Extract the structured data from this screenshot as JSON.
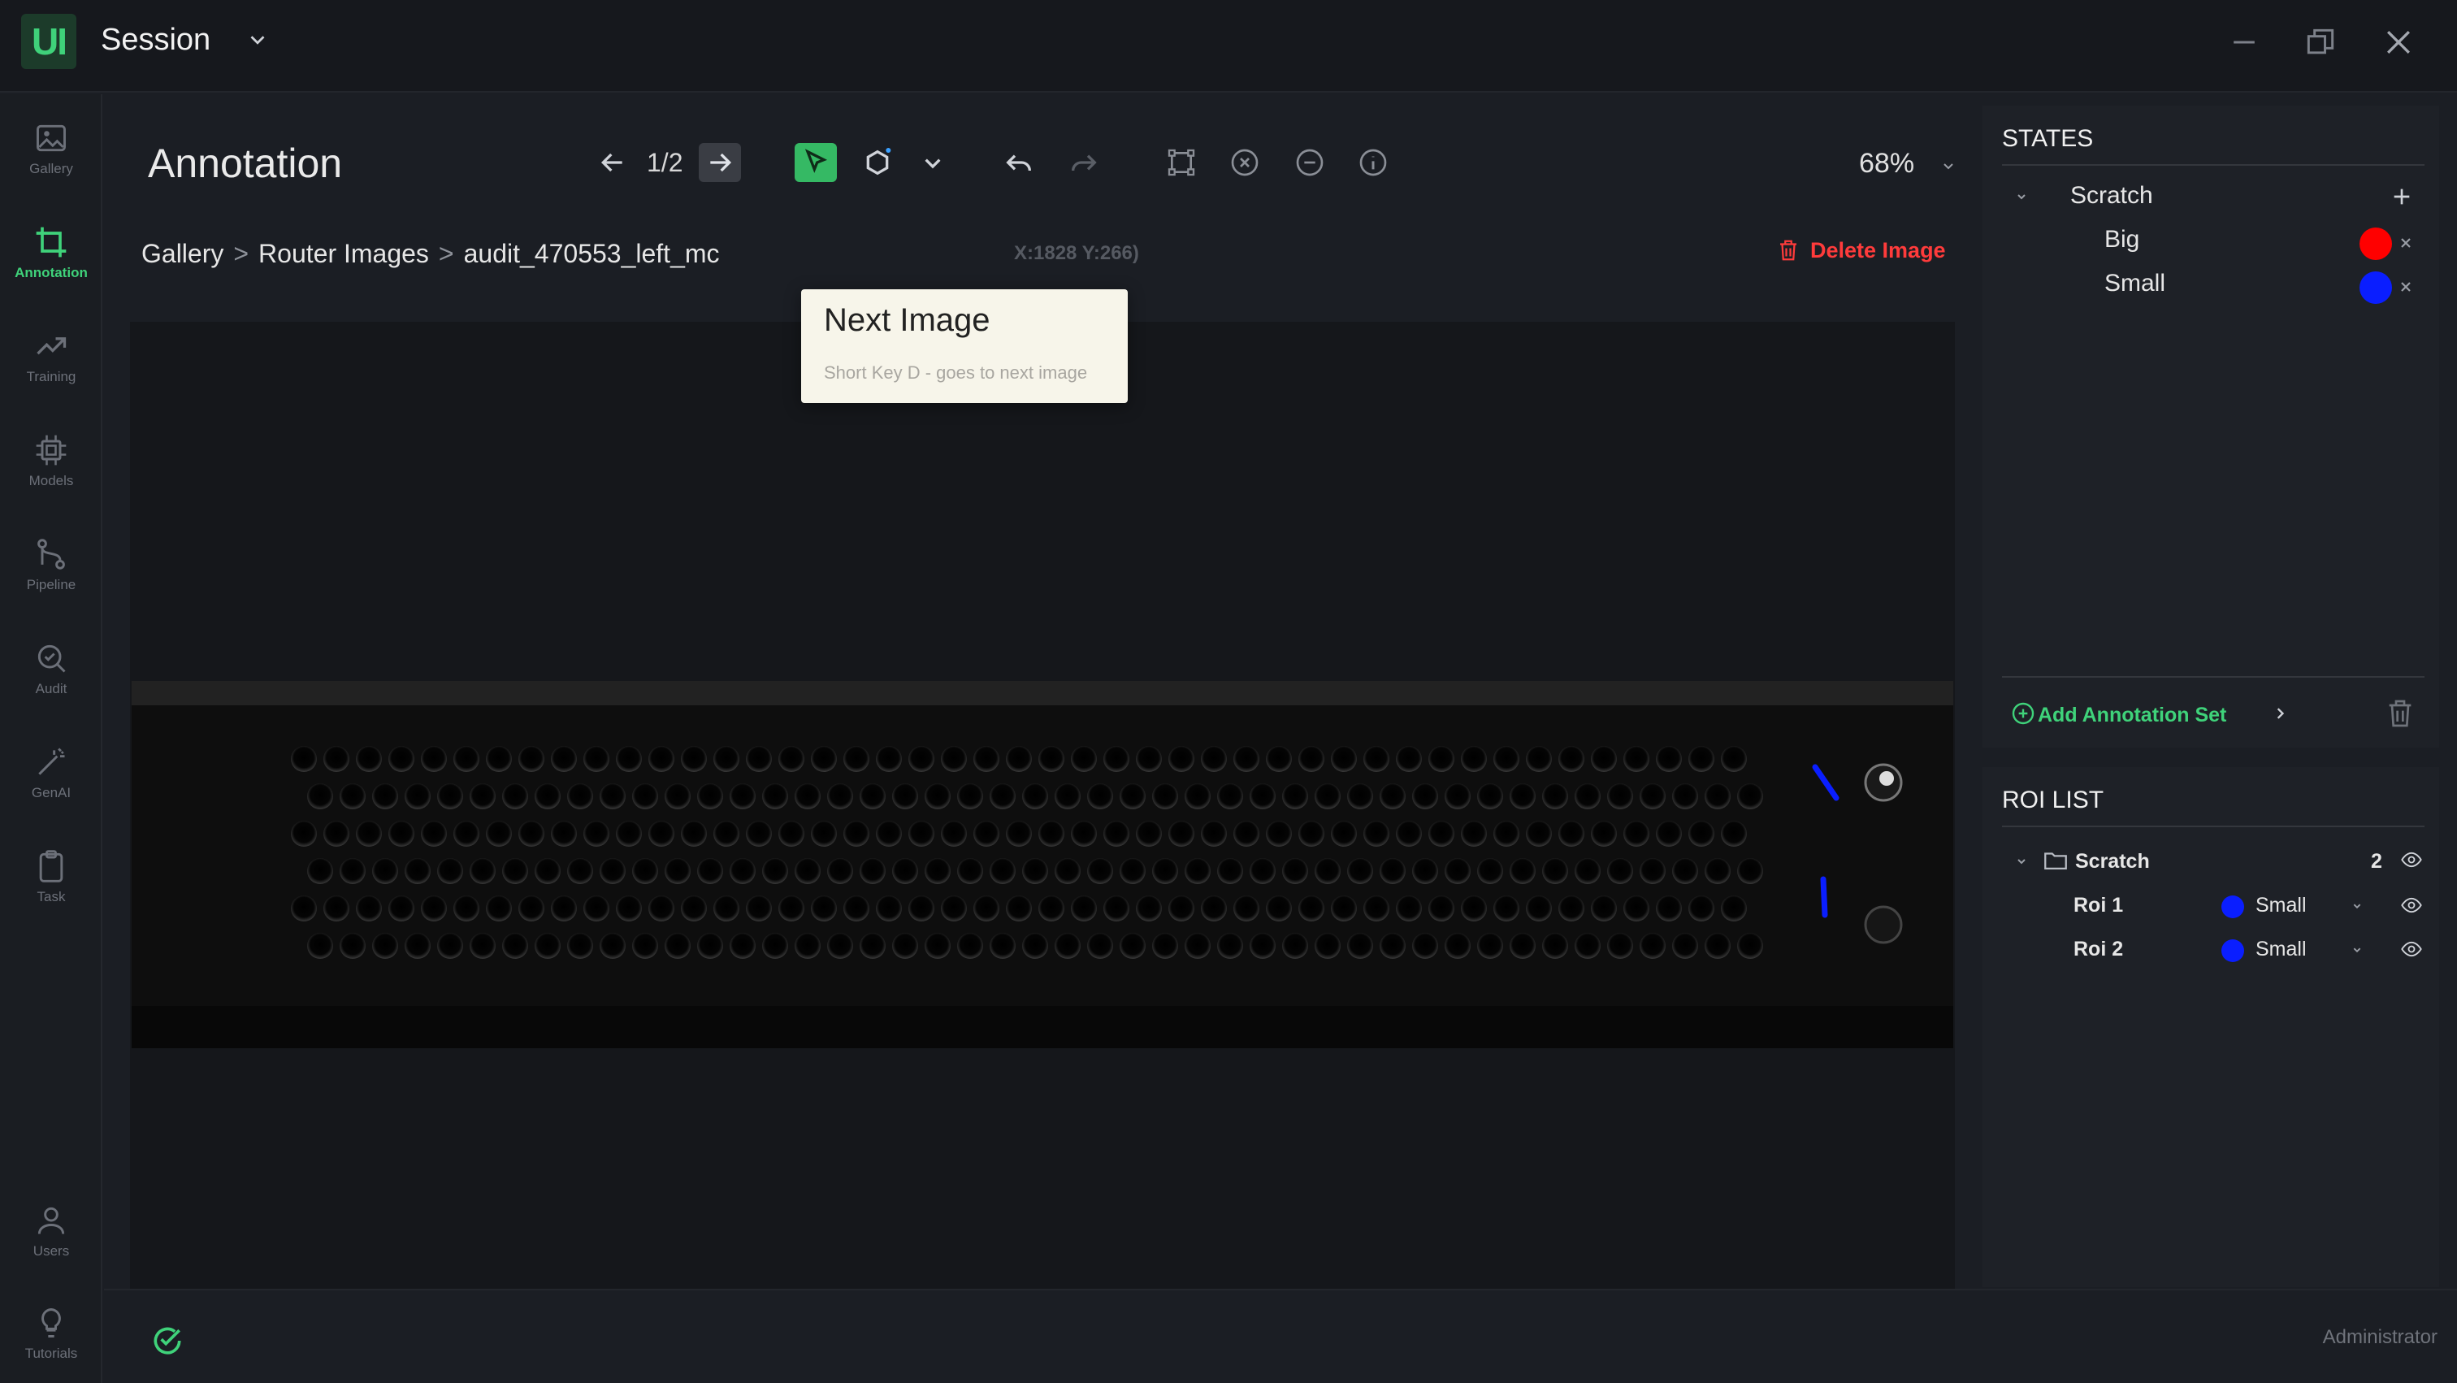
{
  "app": {
    "logo_text": "UI",
    "session_label": "Session"
  },
  "nav": [
    {
      "label": "Gallery",
      "icon": "image-icon"
    },
    {
      "label": "Annotation",
      "icon": "crop-icon",
      "active": true
    },
    {
      "label": "Training",
      "icon": "trend-icon"
    },
    {
      "label": "Models",
      "icon": "chip-icon"
    },
    {
      "label": "Pipeline",
      "icon": "pipeline-icon"
    },
    {
      "label": "Audit",
      "icon": "audit-icon"
    },
    {
      "label": "GenAI",
      "icon": "wand-icon"
    },
    {
      "label": "Task",
      "icon": "clipboard-icon"
    },
    {
      "label": "Users",
      "icon": "user-icon"
    },
    {
      "label": "Tutorials",
      "icon": "bulb-icon"
    }
  ],
  "header": {
    "title": "Annotation",
    "counter": "1/2",
    "zoom": "68%"
  },
  "tooltip": {
    "title": "Next Image",
    "hint": "Short Key D - goes to next image"
  },
  "breadcrumb": {
    "items": [
      "Gallery",
      "Router Images",
      "audit_470553_left_mc"
    ],
    "separator": ">",
    "coords": "X:1828 Y:266)"
  },
  "actions": {
    "delete_image": "Delete Image"
  },
  "states": {
    "header": "STATES",
    "group": "Scratch",
    "items": [
      {
        "label": "Big",
        "color": "#ff0000"
      },
      {
        "label": "Small",
        "color": "#0a1eff"
      }
    ],
    "add_annotation_set": "Add Annotation Set"
  },
  "roi_list": {
    "header": "ROI LIST",
    "group": "Scratch",
    "count": "2",
    "items": [
      {
        "name": "Roi 1",
        "state": "Small",
        "color": "#0a1eff"
      },
      {
        "name": "Roi 2",
        "state": "Small",
        "color": "#0a1eff"
      }
    ]
  },
  "footer": {
    "user": "Administrator"
  },
  "colors": {
    "accent": "#3fd27a",
    "danger": "#ff3b3b"
  }
}
